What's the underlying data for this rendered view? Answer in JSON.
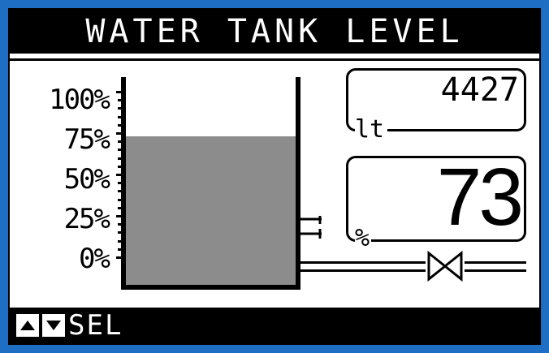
{
  "header": {
    "title": "WATER TANK LEVEL"
  },
  "scale": {
    "labels": [
      "100%",
      "75%",
      "50%",
      "25%",
      "0%"
    ]
  },
  "tank": {
    "level_percent": 73,
    "fill_color": "#8c8c8c"
  },
  "readouts": {
    "volume": {
      "value": "4427",
      "unit": "lt"
    },
    "percent": {
      "value": "73",
      "unit": "%"
    }
  },
  "footer": {
    "up_icon": "triangle-up-icon",
    "down_icon": "triangle-down-icon",
    "sel_label": "SEL"
  },
  "colors": {
    "bezel": "#1e6fc4",
    "screen": "#ffffff",
    "ink": "#000000"
  }
}
